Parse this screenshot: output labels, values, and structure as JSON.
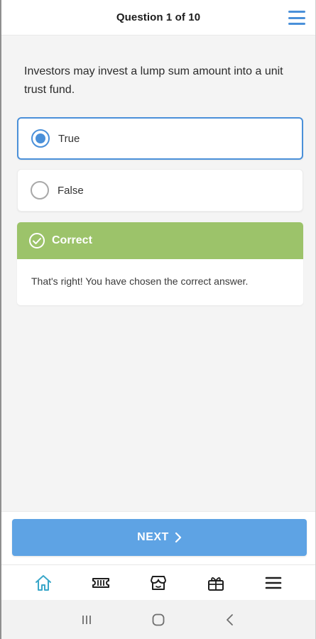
{
  "header": {
    "title": "Question 1 of 10",
    "menu_icon": "hamburger-menu-icon",
    "accent_color": "#4a90d9"
  },
  "question": {
    "text": "Investors may invest a lump sum amount into a unit trust fund."
  },
  "options": [
    {
      "label": "True",
      "selected": true
    },
    {
      "label": "False",
      "selected": false
    }
  ],
  "feedback": {
    "title": "Correct",
    "message": "That's right! You have chosen the correct answer.",
    "icon": "check-circle-icon",
    "color": "#9cc36a"
  },
  "next_button": {
    "label": "NEXT",
    "icon": "chevron-right-icon",
    "color": "#5ea3e4"
  },
  "tabbar": {
    "items": [
      {
        "icon": "home-icon",
        "active": true
      },
      {
        "icon": "ticket-icon",
        "active": false
      },
      {
        "icon": "store-icon",
        "active": false
      },
      {
        "icon": "gift-icon",
        "active": false
      },
      {
        "icon": "menu-icon",
        "active": false
      }
    ],
    "active_color": "#3aa7c9"
  },
  "system_nav": {
    "items": [
      "recent-apps-icon",
      "home-circle-icon",
      "back-icon"
    ]
  }
}
